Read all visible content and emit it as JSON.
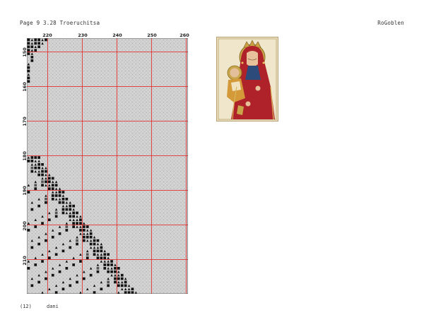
{
  "header": {
    "left": "Page 9  3.28 Troeruchitsa",
    "right": "RoGoblen"
  },
  "footer": {
    "number": "(12)",
    "name": "dani"
  },
  "pattern": {
    "x_labels": [
      "220",
      "230",
      "240",
      "250",
      "260"
    ],
    "y_labels": [
      "150",
      "160",
      "170",
      "180",
      "190",
      "200",
      "210"
    ]
  },
  "preview": {
    "description_icon": "icon-preview-image"
  },
  "colors": {
    "grid_line": "#b8b8b8",
    "major_line": "#e03030",
    "cell_light": "#d9d9d9",
    "symbol_dark": "#111111"
  }
}
